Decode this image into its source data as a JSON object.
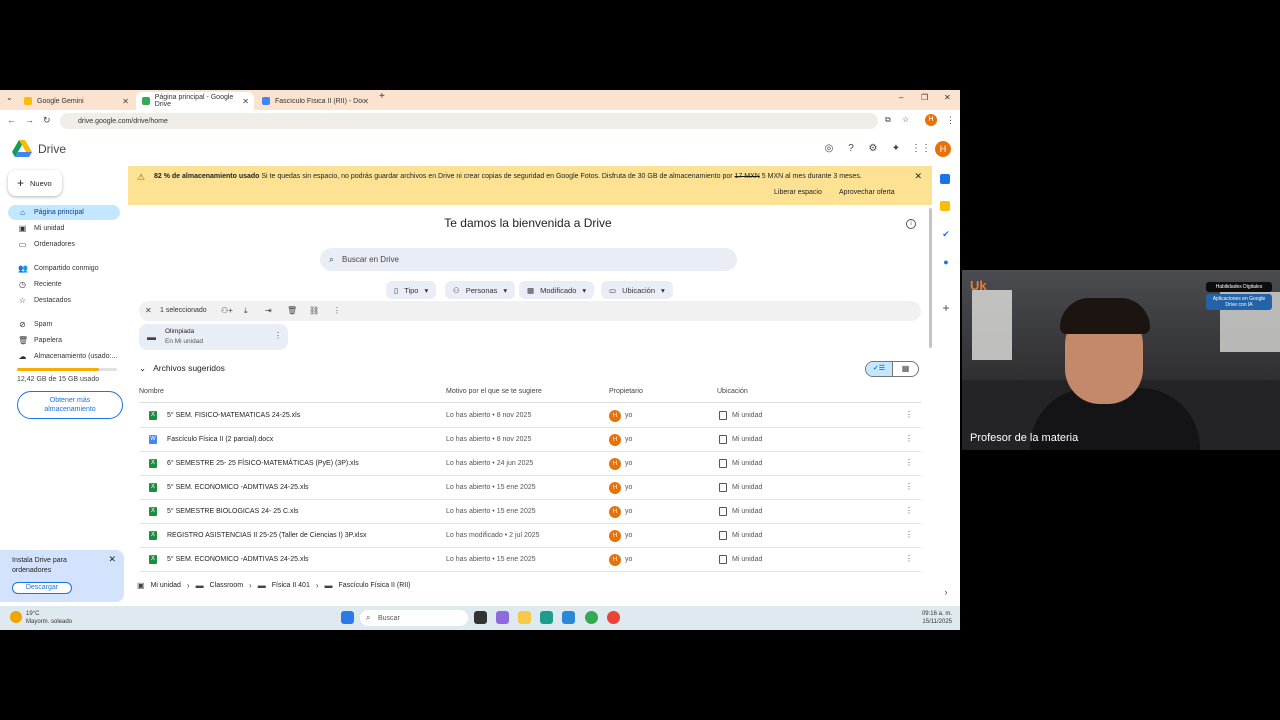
{
  "browser": {
    "tabs": [
      {
        "title": "Google Gemini",
        "active": false
      },
      {
        "title": "Página principal - Google Drive",
        "active": true
      },
      {
        "title": "Fascículo Física II (RII) - Docum",
        "active": false
      }
    ],
    "url": "drive.google.com/drive/home"
  },
  "drive": {
    "logo_text": "Drive",
    "new_button": "Nuevo",
    "avatar_letter": "H",
    "sidebar": [
      {
        "label": "Página principal",
        "icon": "home-icon"
      },
      {
        "label": "Mi unidad",
        "icon": "my-drive-icon"
      },
      {
        "label": "Ordenadores",
        "icon": "computer-icon"
      },
      {
        "label": "Compartido conmigo",
        "icon": "people-icon"
      },
      {
        "label": "Reciente",
        "icon": "clock-icon"
      },
      {
        "label": "Destacados",
        "icon": "star-icon"
      },
      {
        "label": "Spam",
        "icon": "spam-icon"
      },
      {
        "label": "Papelera",
        "icon": "trash-icon"
      },
      {
        "label": "Almacenamiento (usado:...",
        "icon": "cloud-icon"
      }
    ],
    "storage": {
      "text": "12,42 GB de 15 GB usado",
      "fraction": 0.82
    },
    "get_storage": "Obtener más almacenamiento",
    "install_card": {
      "text": "Instala Drive para ordenadores",
      "button": "Descargar"
    },
    "banner": {
      "bold": "82 % de almacenamiento usado",
      "text": " Si te quedas sin espacio, no podrás guardar archivos en Drive ni crear copias de seguridad en Google Fotos. Disfruta de 30 GB de almacenamiento por ",
      "struck": "17 MXN",
      "text_after": " 5 MXN al mes durante 3 meses.",
      "action1": "Liberar espacio",
      "action2": "Aprovechar oferta"
    },
    "welcome": "Te damos la bienvenida a Drive",
    "search_placeholder": "Buscar en Drive",
    "filters": [
      "Tipo",
      "Personas",
      "Modificado",
      "Ubicación"
    ],
    "selection_text": "1 seleccionado",
    "folder": {
      "name": "Olimpiada",
      "location": "En Mi unidad"
    },
    "suggested_title": "Archivos sugeridos",
    "columns": [
      "Nombre",
      "Motivo por el que se te sugiere",
      "Propietario",
      "Ubicación"
    ],
    "files": [
      {
        "name": "5° SEM.  FISICO-MATEMATICAS 24-25.xls",
        "type": "sheet",
        "reason": "Lo has abierto • 8 nov 2025",
        "owner": "yo",
        "location": "Mi unidad"
      },
      {
        "name": "Fascículo Física II (2 parcial).docx",
        "type": "doc",
        "reason": "Lo has abierto • 8 nov 2025",
        "owner": "yo",
        "location": "Mi unidad"
      },
      {
        "name": "6° SEMESTRE  25- 25  FÍSICO-MATEMÁTICAS (PyE) (3P).xls",
        "type": "sheet",
        "reason": "Lo has abierto • 24 jun 2025",
        "owner": "yo",
        "location": "Mi unidad"
      },
      {
        "name": "5° SEM. ECONOMICO -ADMTIVAS  24-25.xls",
        "type": "sheet",
        "reason": "Lo has abierto • 15 ene 2025",
        "owner": "yo",
        "location": "Mi unidad"
      },
      {
        "name": "5° SEMESTRE BIOLOGICAS 24- 25 C.xls",
        "type": "sheet",
        "reason": "Lo has abierto • 15 ene 2025",
        "owner": "yo",
        "location": "Mi unidad"
      },
      {
        "name": "REGISTRO ASISTENCIAS II 25-25 (Taller de Ciencias I) 3P.xlsx",
        "type": "sheet",
        "reason": "Lo has modificado • 2 jul 2025",
        "owner": "yo",
        "location": "Mi unidad"
      },
      {
        "name": "5° SEM. ECONOMICO -ADMTIVAS  24-25.xls",
        "type": "sheet",
        "reason": "Lo has abierto • 15 ene 2025",
        "owner": "yo",
        "location": "Mi unidad"
      }
    ],
    "breadcrumbs": [
      "Mi unidad",
      "Classroom",
      "Física II 401",
      "Fascículo Física II (RII)"
    ]
  },
  "taskbar": {
    "weather_temp": "19°C",
    "weather_text": "Mayorm. soleado",
    "search": "Buscar",
    "time": "09:16 a. m.",
    "date": "15/11/2025"
  },
  "webcam": {
    "label": "Profesor de la materia",
    "logo": "Uk",
    "badge1": "Habilidades Digitales",
    "badge2": "Aplicaciones en Google Drive con IA"
  },
  "colors": {
    "sheet": "#1e8e3e",
    "doc": "#4285f4",
    "banner": "#fde293",
    "active_nav": "#c2e7ff"
  }
}
